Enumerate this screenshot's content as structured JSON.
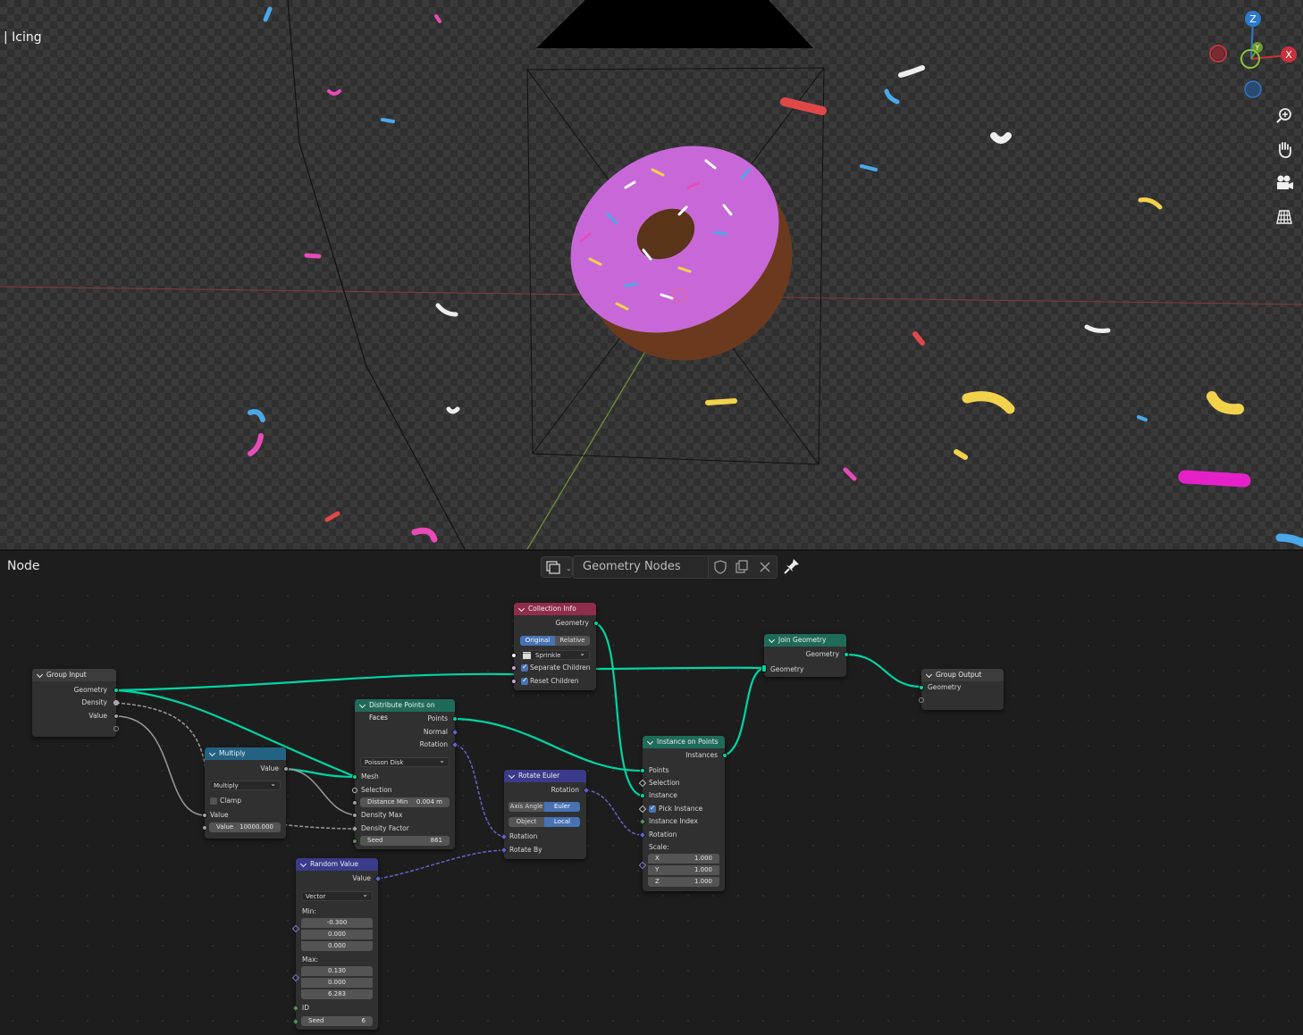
{
  "viewport": {
    "object_name": "| Icing",
    "gizmo": {
      "z_label": "Z",
      "y_label": "Y",
      "x_label": "X"
    },
    "tools": [
      "zoom-icon",
      "hand-icon",
      "camera-icon",
      "grid-icon"
    ]
  },
  "node_editor": {
    "editor_title": "Node",
    "tree_name": "Geometry Nodes",
    "nodes": {
      "group_input": {
        "title": "Group Input",
        "outputs": [
          "Geometry",
          "Density",
          "Value"
        ]
      },
      "multiply": {
        "title": "Multiply",
        "output": "Value",
        "operation": "Multiply",
        "clamp_label": "Clamp",
        "input_label": "Value",
        "value_label": "Value",
        "value": "10000.000"
      },
      "distribute": {
        "title": "Distribute Points on Faces",
        "outputs": [
          "Points",
          "Normal",
          "Rotation"
        ],
        "mode": "Poisson Disk",
        "mesh": "Mesh",
        "selection": "Selection",
        "distance_label": "Distance Min",
        "distance_value": "0.004 m",
        "density_max": "Density Max",
        "density_factor": "Density Factor",
        "seed_label": "Seed",
        "seed_value": "861"
      },
      "collection_info": {
        "title": "Collection Info",
        "output": "Geometry",
        "seg_a": "Original",
        "seg_b": "Relative",
        "collection": "Sprinkle",
        "separate": "Separate Children",
        "reset": "Reset Children"
      },
      "rotate_euler": {
        "title": "Rotate Euler",
        "output": "Rotation",
        "seg_a": "Axis Angle",
        "seg_b": "Euler",
        "seg_c": "Object",
        "seg_d": "Local",
        "in_a": "Rotation",
        "in_b": "Rotate By"
      },
      "random_value": {
        "title": "Random Value",
        "output": "Value",
        "type": "Vector",
        "min_label": "Min:",
        "min": [
          "-0.300",
          "0.000",
          "0.000"
        ],
        "max_label": "Max:",
        "max": [
          "0.130",
          "0.000",
          "6.283"
        ],
        "id_label": "ID",
        "seed_label": "Seed",
        "seed_value": "6"
      },
      "instance_on_points": {
        "title": "Instance on Points",
        "output": "Instances",
        "inputs": [
          "Points",
          "Selection",
          "Instance",
          "Pick Instance",
          "Instance Index",
          "Rotation"
        ],
        "scale_label": "Scale:",
        "x_label": "X",
        "x": "1.000",
        "y_label": "Y",
        "y": "1.000",
        "z_label": "Z",
        "z": "1.000"
      },
      "join_geometry": {
        "title": "Join Geometry",
        "output": "Geometry",
        "input": "Geometry"
      },
      "group_output": {
        "title": "Group Output",
        "input": "Geometry"
      }
    }
  },
  "colors": {
    "geometry_socket": "#00d6a3",
    "vector_socket": "#6363c7",
    "accent_blue": "#4772b3",
    "node_bg": "#303030"
  }
}
